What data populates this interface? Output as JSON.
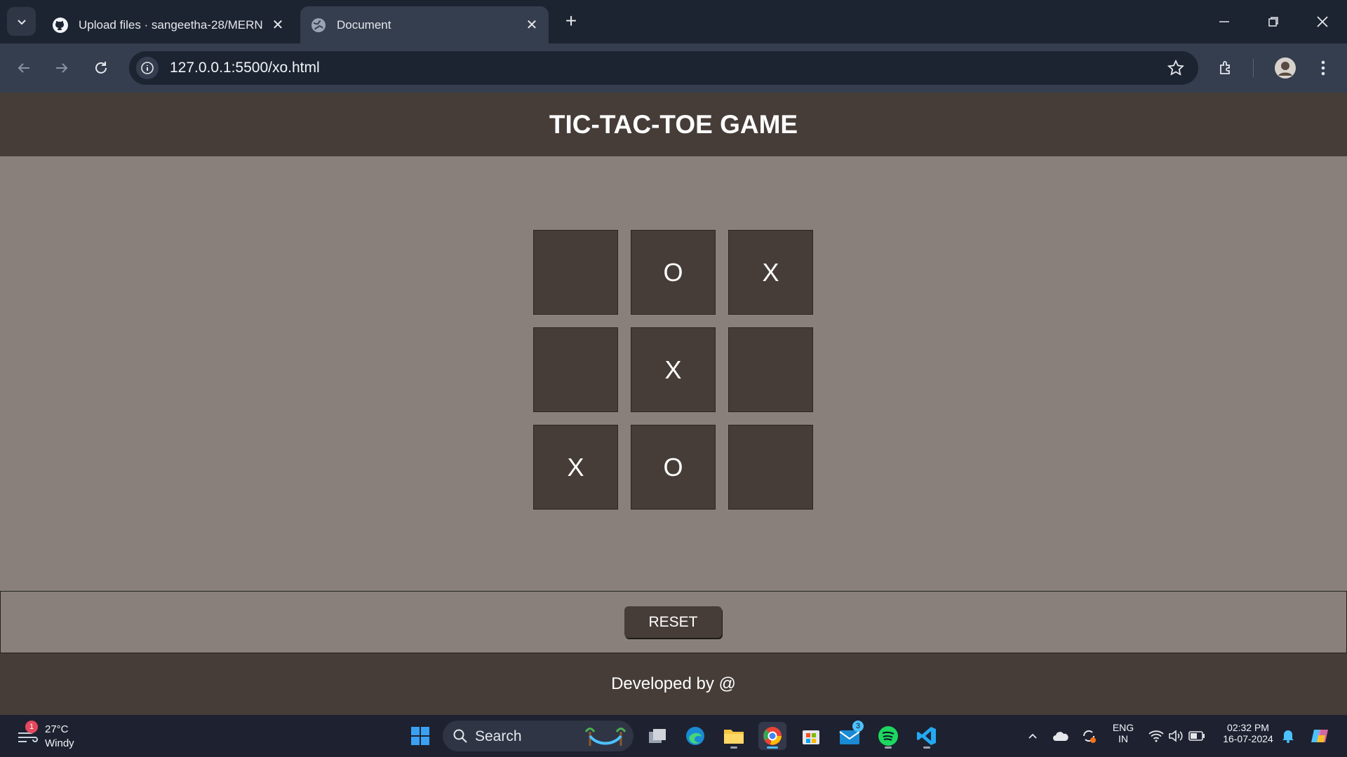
{
  "browser": {
    "tabs": [
      {
        "title": "Upload files · sangeetha-28/MERN",
        "favicon": "github-icon",
        "active": false
      },
      {
        "title": "Document",
        "favicon": "globe-icon",
        "active": true
      }
    ],
    "url": "127.0.0.1:5500/xo.html"
  },
  "page": {
    "header_title": "TIC-TAC-TOE GAME",
    "board": [
      "",
      "O",
      "X",
      "",
      "X",
      "",
      "X",
      "O",
      ""
    ],
    "reset_label": "RESET",
    "footer_text": "Developed by @"
  },
  "taskbar": {
    "weather": {
      "temp": "27°C",
      "condition": "Windy",
      "badge": "1"
    },
    "search_label": "Search",
    "mail_badge": "3",
    "lang": "ENG",
    "region": "IN",
    "time": "02:32 PM",
    "date": "16-07-2024"
  }
}
